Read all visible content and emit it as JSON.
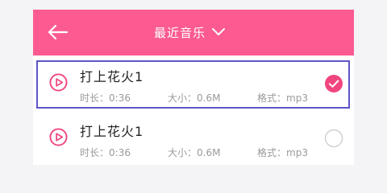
{
  "header": {
    "title": "最近音乐",
    "back_icon": "arrow-left-icon",
    "dropdown_icon": "chevron-down-icon",
    "background_color": "#fb5b91"
  },
  "songs": [
    {
      "title": "打上花火1",
      "duration_label": "时长：",
      "duration": "0:36",
      "size_label": "大小：",
      "size": "0.6M",
      "format_label": "格式：",
      "format": "mp3",
      "checked": true,
      "focused": true
    },
    {
      "title": "打上花火1",
      "duration_label": "时长：",
      "duration": "0:36",
      "size_label": "大小：",
      "size": "0.6M",
      "format_label": "格式：",
      "format": "mp3",
      "checked": false,
      "focused": false
    }
  ],
  "colors": {
    "accent": "#f0457f",
    "focus_border": "#5e55c9",
    "meta_text": "#9a9a9a",
    "unchecked_circle": "#cfcfcf"
  }
}
